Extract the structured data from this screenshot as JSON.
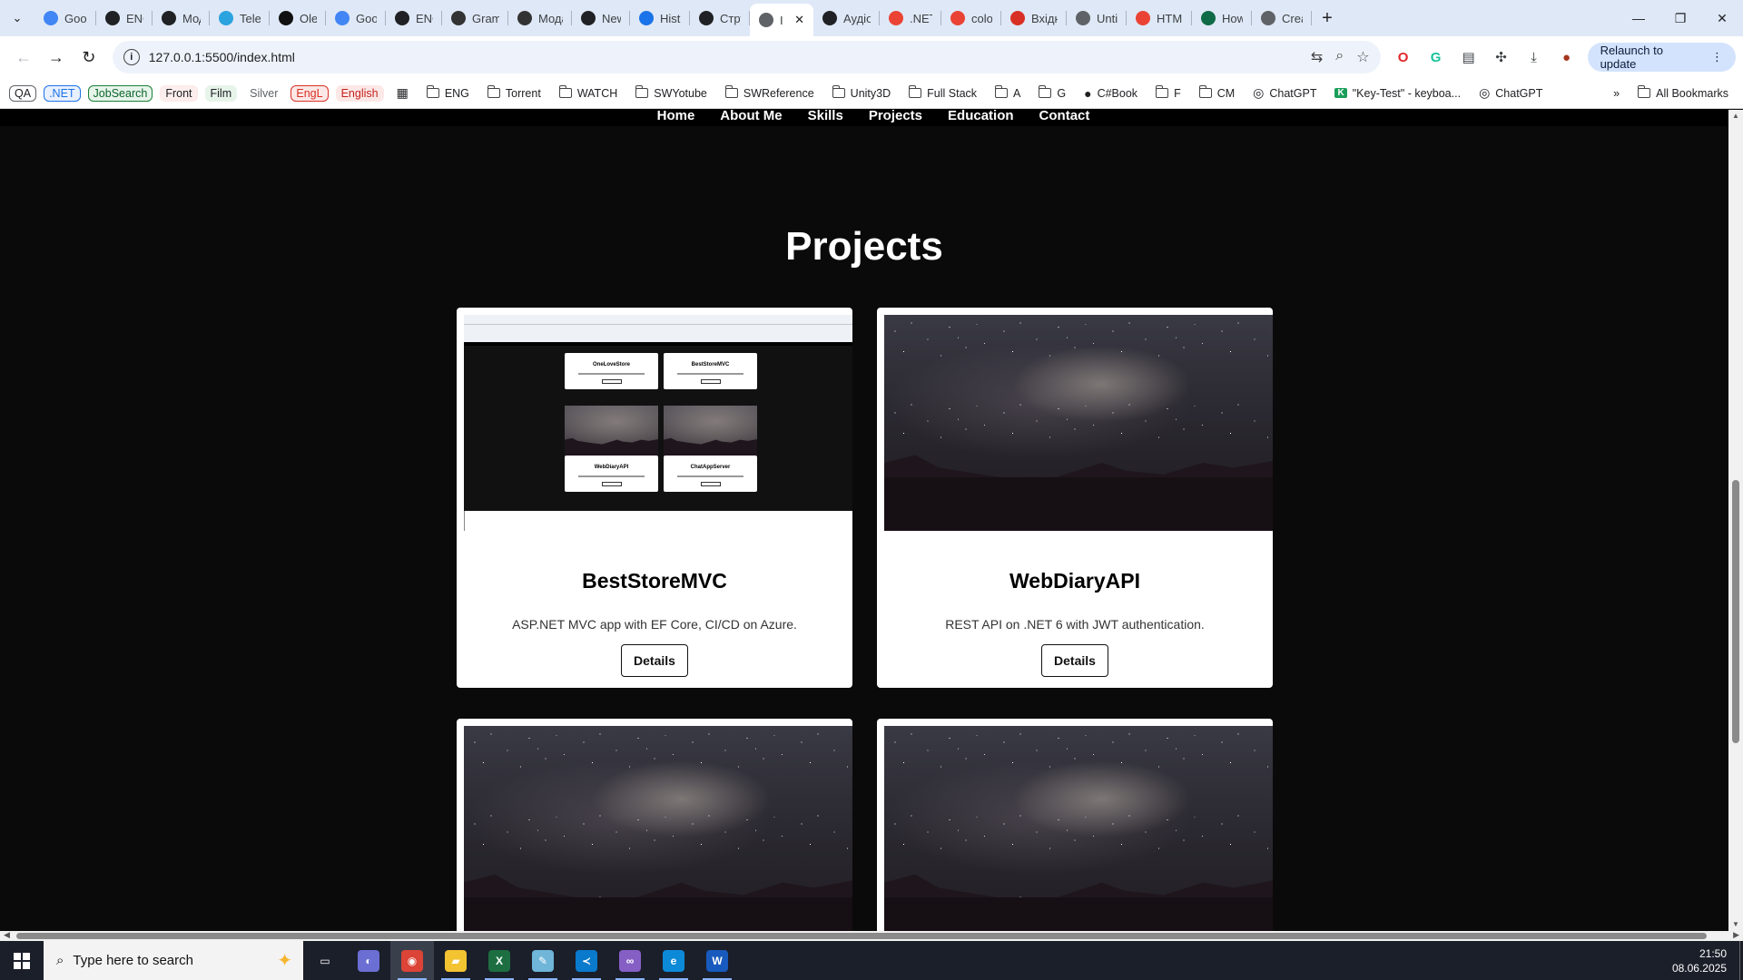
{
  "browser": {
    "tabs": [
      {
        "label": "Googl",
        "icon": "google-docs-icon",
        "color": "#4285f4"
      },
      {
        "label": "ENG -",
        "icon": "chatgpt-icon",
        "color": "#202124"
      },
      {
        "label": "Мода",
        "icon": "chatgpt-icon",
        "color": "#202124"
      },
      {
        "label": "Teleg",
        "icon": "telegram-icon",
        "color": "#2aa3df"
      },
      {
        "label": "Olesia",
        "icon": "notion-icon",
        "color": "#111111"
      },
      {
        "label": "Goog",
        "icon": "google-docs-icon",
        "color": "#4285f4"
      },
      {
        "label": "ENG",
        "icon": "chatgpt-icon",
        "color": "#202124"
      },
      {
        "label": "Gram",
        "icon": "gw-icon",
        "color": "#333333"
      },
      {
        "label": "Мода",
        "icon": "gw-icon",
        "color": "#333333"
      },
      {
        "label": "New T",
        "icon": "chatgpt-icon",
        "color": "#202124"
      },
      {
        "label": "Histor",
        "icon": "history-icon",
        "color": "#1a73e8"
      },
      {
        "label": "Струк",
        "icon": "chatgpt-icon",
        "color": "#202124"
      },
      {
        "label": "III",
        "icon": "globe-icon",
        "color": "#5f6368",
        "active": true
      },
      {
        "label": "Аудіо",
        "icon": "chatgpt-icon",
        "color": "#202124"
      },
      {
        "label": ".NET c",
        "icon": "google-icon",
        "color": "#ea4335"
      },
      {
        "label": "color",
        "icon": "google-icon",
        "color": "#ea4335"
      },
      {
        "label": "Вхідні",
        "icon": "gmail-icon",
        "color": "#d93025"
      },
      {
        "label": "Untitl",
        "icon": "figma-icon",
        "color": "#5f6368"
      },
      {
        "label": "HTML",
        "icon": "google-icon",
        "color": "#ea4335"
      },
      {
        "label": "How t",
        "icon": "gw-icon",
        "color": "#0f6b47"
      },
      {
        "label": "Create",
        "icon": "globe-icon",
        "color": "#5f6368"
      }
    ],
    "url": "127.0.0.1:5500/index.html",
    "relaunch_label": "Relaunch to update",
    "bookmark_chips": [
      {
        "label": "QA",
        "border": "#5f6368",
        "color": "#202124"
      },
      {
        "label": ".NET",
        "border": "#1a73e8",
        "color": "#1a73e8",
        "bg": "#e8f0fe"
      },
      {
        "label": "JobSearch",
        "border": "#188038",
        "color": "#0d652d",
        "bg": "#e6f4ea"
      },
      {
        "label": "Front",
        "border": "#fce8e6",
        "color": "#202124",
        "bg": "#fdeeee"
      },
      {
        "label": "Film",
        "border": "#e6f4ea",
        "color": "#202124",
        "bg": "#e6f4ea"
      },
      {
        "label": "Silver",
        "border": "#ffffff",
        "color": "#5f6368"
      },
      {
        "label": "EngL",
        "border": "#d93025",
        "color": "#d93025",
        "bg": "#fce8e6"
      },
      {
        "label": "English",
        "border": "#fce8e6",
        "color": "#c5221f",
        "bg": "#fce8e6"
      }
    ],
    "bookmarks": [
      {
        "label": "ENG",
        "icon": "folder-icon"
      },
      {
        "label": "Torrent",
        "icon": "folder-icon"
      },
      {
        "label": "WATCH",
        "icon": "folder-icon"
      },
      {
        "label": "SWYotube",
        "icon": "folder-icon"
      },
      {
        "label": "SWReference",
        "icon": "folder-icon"
      },
      {
        "label": "Unity3D",
        "icon": "folder-icon"
      },
      {
        "label": "Full Stack",
        "icon": "folder-icon"
      },
      {
        "label": "A",
        "icon": "folder-icon"
      },
      {
        "label": "G",
        "icon": "folder-icon"
      },
      {
        "label": "C#Book",
        "icon": "github-icon"
      },
      {
        "label": "F",
        "icon": "folder-icon"
      },
      {
        "label": "CM",
        "icon": "folder-icon"
      },
      {
        "label": "ChatGPT",
        "icon": "chatgpt-icon"
      },
      {
        "label": "\"Key-Test\" - keyboa...",
        "icon": "keytest-icon"
      },
      {
        "label": "ChatGPT",
        "icon": "chatgpt-icon"
      }
    ],
    "all_bookmarks_label": "All Bookmarks"
  },
  "site": {
    "nav": [
      "Home",
      "About Me",
      "Skills",
      "Projects",
      "Education",
      "Contact"
    ],
    "section_title": "Projects",
    "projects": [
      {
        "title": "BestStoreMVC",
        "description": "ASP.NET MVC app with EF Core, CI/CD on Azure.",
        "button": "Details",
        "image": "screenshot"
      },
      {
        "title": "WebDiaryAPI",
        "description": "REST API on .NET 6 with JWT authentication.",
        "button": "Details",
        "image": "night-sky"
      },
      {
        "title": "",
        "description": "",
        "button": "",
        "image": "night-sky"
      },
      {
        "title": "",
        "description": "",
        "button": "",
        "image": "night-sky"
      }
    ],
    "mini_preview_titles": [
      "OneLoveStore",
      "BestStoreMVC",
      "WebDiaryAPI",
      "ChatAppServer"
    ]
  },
  "taskbar": {
    "search_placeholder": "Type here to search",
    "time": "21:50",
    "date": "08.06.2025",
    "apps": [
      {
        "name": "task-view-icon",
        "color": "#1b1f2a"
      },
      {
        "name": "copilot-icon",
        "color": "#6b6fd4"
      },
      {
        "name": "chrome-icon",
        "color": "#db4437",
        "active": true
      },
      {
        "name": "file-explorer-icon",
        "color": "#f3c332"
      },
      {
        "name": "excel-icon",
        "color": "#1d6f42"
      },
      {
        "name": "notepad-icon",
        "color": "#6fb6d9"
      },
      {
        "name": "vscode-icon",
        "color": "#0a7acc"
      },
      {
        "name": "visual-studio-icon",
        "color": "#865fc5"
      },
      {
        "name": "edge-icon",
        "color": "#0c8ad8"
      },
      {
        "name": "word-icon",
        "color": "#185abd"
      }
    ]
  }
}
